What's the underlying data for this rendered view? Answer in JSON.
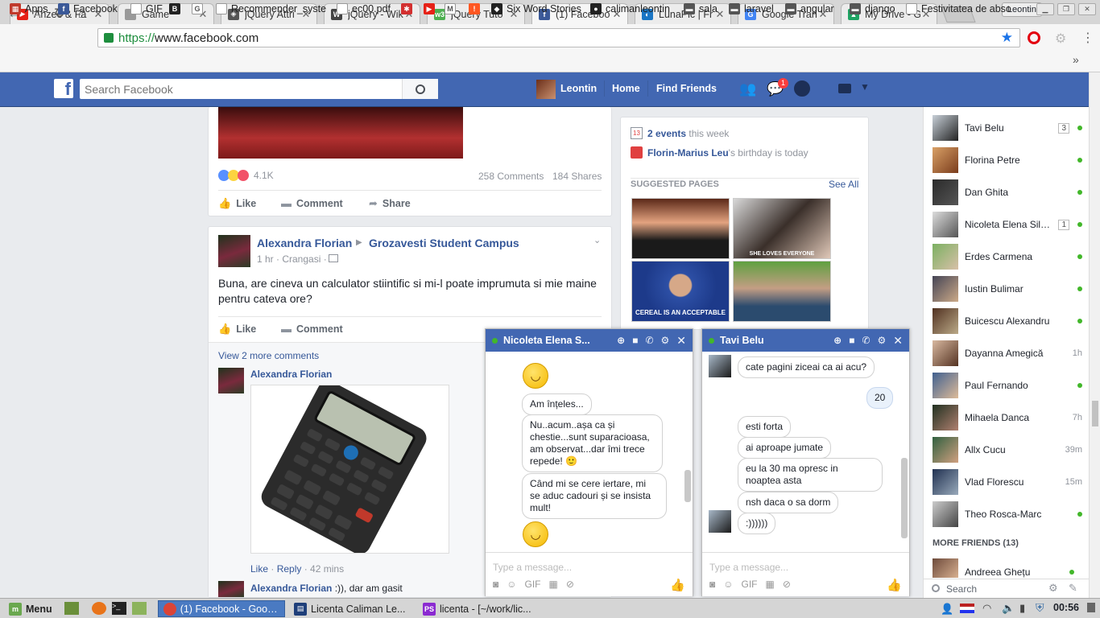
{
  "browser": {
    "tabs": [
      {
        "title": "Ahzee & Fa",
        "icon": "youtube-icon",
        "color": "#e62117",
        "glyph": "▶"
      },
      {
        "title": "Game",
        "icon": "page-icon",
        "color": "#999999",
        "glyph": ""
      },
      {
        "title": "jQuery Attri",
        "icon": "jquery-icon",
        "color": "#555555",
        "glyph": "◈"
      },
      {
        "title": "jQuery - Wik",
        "icon": "wikipedia-icon",
        "color": "#444444",
        "glyph": "W"
      },
      {
        "title": "jQuery Tuto",
        "icon": "w3schools-icon",
        "color": "#4caf50",
        "glyph": "w3"
      },
      {
        "title": "(1) Faceboo",
        "icon": "facebook-icon",
        "color": "#3b5998",
        "glyph": "f"
      },
      {
        "title": "LunaPic | Fr",
        "icon": "lunapic-icon",
        "color": "#1a75c4",
        "glyph": "◐"
      },
      {
        "title": "Google Tran",
        "icon": "google-translate-icon",
        "color": "#4285f4",
        "glyph": "G"
      },
      {
        "title": "My Drive - G",
        "icon": "google-drive-icon",
        "color": "#1fa463",
        "glyph": "▲"
      }
    ],
    "profile_name": "Leontin",
    "url_scheme": "https://",
    "url_host": "www.facebook.com",
    "bookmarks": [
      {
        "label": "Apps",
        "icon": "apps-grid-icon",
        "color": "#c0392b",
        "glyph": "▦"
      },
      {
        "label": "Facebook",
        "icon": "facebook-icon",
        "color": "#3b5998",
        "glyph": "f"
      },
      {
        "label": "GIF",
        "icon": "page-icon",
        "color": "#ffffff",
        "glyph": ""
      },
      {
        "label": "",
        "icon": "bootstrap-icon",
        "color": "#222222",
        "glyph": "B"
      },
      {
        "label": "",
        "icon": "google-icon",
        "color": "#ffffff",
        "glyph": "G"
      },
      {
        "label": "Recommender_syste",
        "icon": "page-icon",
        "color": "#ffffff",
        "glyph": ""
      },
      {
        "label": "ec00.pdf",
        "icon": "page-icon",
        "color": "#ffffff",
        "glyph": ""
      },
      {
        "label": "",
        "icon": "settings-red-icon",
        "color": "#d32f2f",
        "glyph": "✱"
      },
      {
        "label": "",
        "icon": "youtube-icon",
        "color": "#e62117",
        "glyph": "▶"
      },
      {
        "label": "",
        "icon": "gmail-icon",
        "color": "#ffffff",
        "glyph": "M"
      },
      {
        "label": "",
        "icon": "alert-icon",
        "color": "#ff5722",
        "glyph": "!"
      },
      {
        "label": "Six Word Stories",
        "icon": "six-word-icon",
        "color": "#222222",
        "glyph": "◆"
      },
      {
        "label": "calimanleontin",
        "icon": "github-icon",
        "color": "#222222",
        "glyph": "●"
      },
      {
        "label": "sala",
        "icon": "folder-icon",
        "color": "#555555",
        "glyph": "▬"
      },
      {
        "label": "laravel",
        "icon": "folder-icon",
        "color": "#555555",
        "glyph": "▬"
      },
      {
        "label": "angular",
        "icon": "folder-icon",
        "color": "#555555",
        "glyph": "▬"
      },
      {
        "label": "django",
        "icon": "folder-icon",
        "color": "#555555",
        "glyph": "▬"
      },
      {
        "label": "Festivitatea de abso",
        "icon": "page-icon",
        "color": "#ffffff",
        "glyph": ""
      }
    ]
  },
  "fb": {
    "search_placeholder": "Search Facebook",
    "user": "Leontin",
    "nav": [
      "Home",
      "Find Friends"
    ],
    "notif_count": "1",
    "post1": {
      "reactions": "4.1K",
      "comments": "258 Comments",
      "shares": "184 Shares",
      "actions": [
        "Like",
        "Comment",
        "Share"
      ]
    },
    "post2": {
      "author": "Alexandra Florian",
      "group": "Grozavesti Student Campus",
      "meta": "1 hr · Crangasi ·",
      "text": "Buna, are cineva un calculator stiintific si mi-l poate imprumuta si mie maine pentru cateva ore?",
      "actions": [
        "Like",
        "Comment"
      ],
      "view_more": "View 2 more comments",
      "comment1_author": "Alexandra Florian",
      "comment1_like": "Like",
      "comment1_reply": "Reply",
      "comment1_time": "42 mins",
      "comment2_author": "Alexandra Florian",
      "comment2_text": ":)), dar am gasit"
    },
    "right": {
      "events_count": "2 events",
      "events_suffix": " this week",
      "birthday_name": "Florin-Marius Leu",
      "birthday_suffix": "'s birthday is today",
      "calendar_day": "13",
      "suggested": "SUGGESTED PAGES",
      "see_all": "See All",
      "sp3_caption": "CEREAL IS AN ACCEPTABLE",
      "sp2_caption": "SHE LOVES EVERYONE"
    },
    "friends": [
      {
        "name": "Tavi Belu",
        "badge": "3",
        "status": "online",
        "time": ""
      },
      {
        "name": "Florina Petre",
        "badge": "",
        "status": "online",
        "time": ""
      },
      {
        "name": "Dan Ghita",
        "badge": "",
        "status": "online",
        "time": ""
      },
      {
        "name": "Nicoleta Elena Sil…",
        "badge": "1",
        "status": "online",
        "time": ""
      },
      {
        "name": "Erdes Carmena",
        "badge": "",
        "status": "online",
        "time": ""
      },
      {
        "name": "Iustin Bulimar",
        "badge": "",
        "status": "online",
        "time": ""
      },
      {
        "name": "Buicescu Alexandru",
        "badge": "",
        "status": "online",
        "time": ""
      },
      {
        "name": "Dayanna Amegică",
        "badge": "",
        "status": "idle",
        "time": "1h"
      },
      {
        "name": "Paul Fernando",
        "badge": "",
        "status": "online",
        "time": ""
      },
      {
        "name": "Mihaela Danca",
        "badge": "",
        "status": "idle",
        "time": "7h"
      },
      {
        "name": "Allx Cucu",
        "badge": "",
        "status": "idle",
        "time": "39m"
      },
      {
        "name": "Vlad Florescu",
        "badge": "",
        "status": "idle",
        "time": "15m"
      },
      {
        "name": "Theo Rosca-Marc",
        "badge": "",
        "status": "online",
        "time": ""
      }
    ],
    "more_friends": "MORE FRIENDS (13)",
    "more_friend": "Andreea Ghețu",
    "chat_search": "Search"
  },
  "chat1": {
    "name": "Nicoleta Elena S...",
    "m1": "Am înțeles...",
    "m2": "Nu..acum..așa ca și chestie...sunt suparacioasa, am observat...dar îmi trece repede! 🙂",
    "m3": "Când mi se cere iertare, mi se aduc cadouri și se insista mult!",
    "placeholder": "Type a message...",
    "gif": "GIF"
  },
  "chat2": {
    "name": "Tavi Belu",
    "m1": "cate pagini ziceai ca ai acu?",
    "mine": "20",
    "m2": "esti forta",
    "m3": "ai aproape jumate",
    "m4": "eu la 30 ma opresc in noaptea asta",
    "m5": "nsh daca o sa dorm",
    "m6": ":))))))",
    "placeholder": "Type a message...",
    "gif": "GIF"
  },
  "taskbar": {
    "menu": "Menu",
    "win1": "(1) Facebook - Goog...",
    "win2": "Licenta Caliman Le...",
    "win3": "licenta - [~/work/lic...",
    "clock": "00:56"
  }
}
